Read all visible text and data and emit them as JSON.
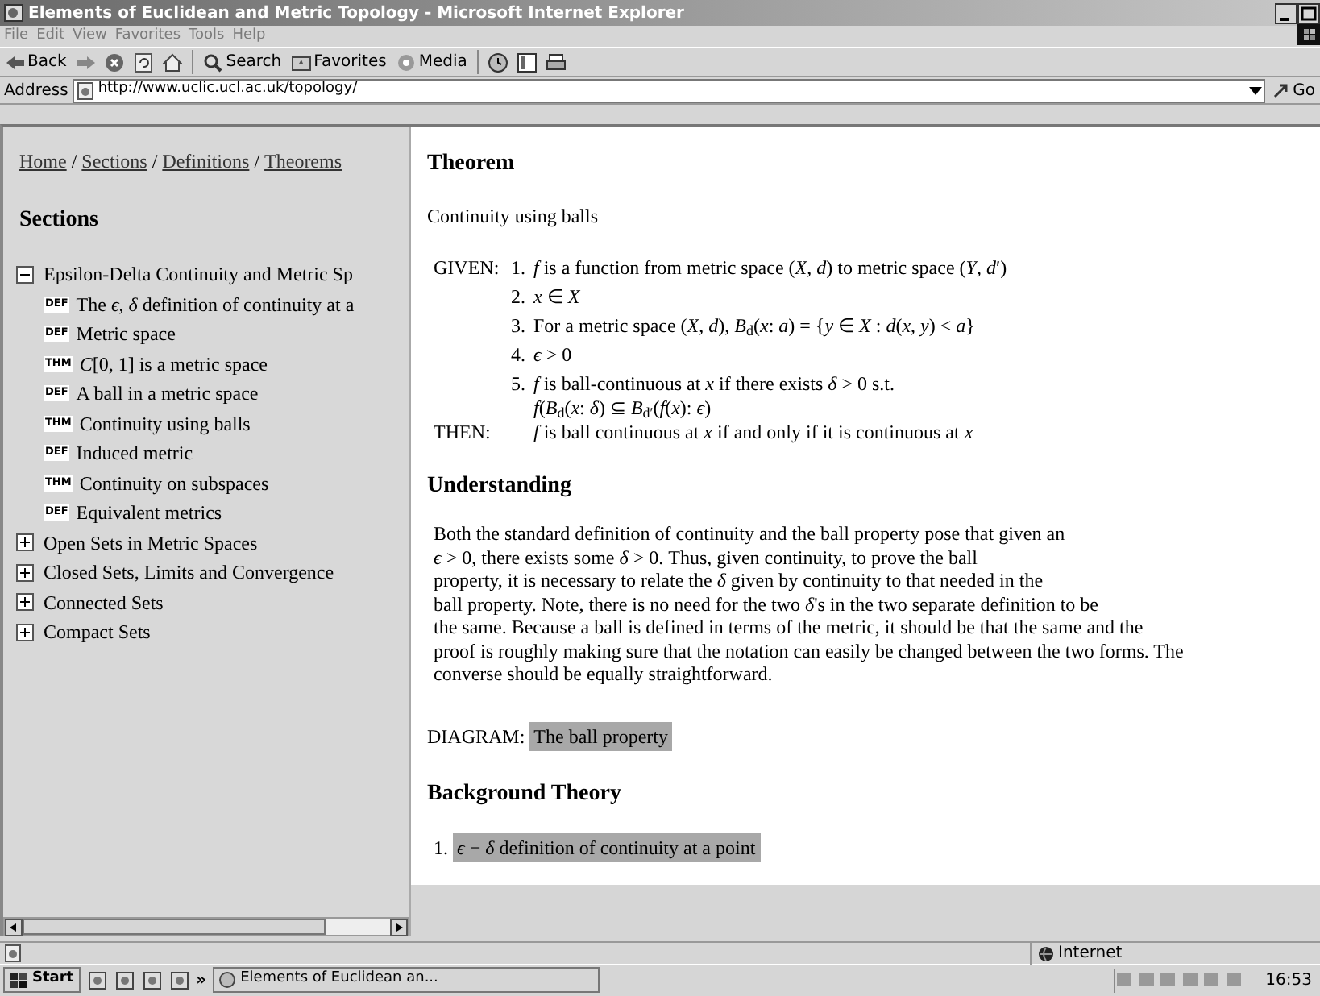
{
  "window": {
    "title": "Elements of Euclidean and Metric Topology - Microsoft Internet Explorer"
  },
  "menu": [
    "File",
    "Edit",
    "View",
    "Favorites",
    "Tools",
    "Help"
  ],
  "toolbar": [
    {
      "kind": "back",
      "label": "Back"
    },
    {
      "kind": "forward"
    },
    {
      "kind": "stop"
    },
    {
      "kind": "refresh"
    },
    {
      "kind": "home"
    },
    {
      "kind": "search",
      "label": "Search"
    },
    {
      "kind": "favorites",
      "label": "Favorites"
    },
    {
      "kind": "media",
      "label": "Media"
    },
    {
      "kind": "history"
    },
    {
      "kind": "fullscreen"
    },
    {
      "kind": "print"
    }
  ],
  "address": {
    "label": "Address",
    "value": "http://www.uclic.ucl.ac.uk/topology/",
    "go": "Go"
  },
  "sidebar": {
    "breadcrumb": [
      "Home",
      "Sections",
      "Definitions",
      "Theorems"
    ],
    "separator": "/",
    "heading": "Sections",
    "sections": [
      {
        "label": "Epsilon-Delta Continuity and Metric Sp",
        "expanded": true,
        "children": [
          {
            "tag": "DEF",
            "label": "The *ϵ*, *δ* definition of continuity at a"
          },
          {
            "tag": "DEF",
            "label": "Metric space"
          },
          {
            "tag": "THM",
            "label": "*C*[0, 1] is a metric space"
          },
          {
            "tag": "DEF",
            "label": "A ball in a metric space"
          },
          {
            "tag": "THM",
            "label": "Continuity using balls"
          },
          {
            "tag": "DEF",
            "label": "Induced metric"
          },
          {
            "tag": "THM",
            "label": "Continuity on subspaces"
          },
          {
            "tag": "DEF",
            "label": "Equivalent metrics"
          }
        ]
      },
      {
        "label": "Open Sets in Metric Spaces",
        "expanded": false
      },
      {
        "label": "Closed Sets, Limits and Convergence",
        "expanded": false
      },
      {
        "label": "Connected Sets",
        "expanded": false
      },
      {
        "label": "Compact Sets",
        "expanded": false
      }
    ]
  },
  "main": {
    "heading": "Theorem",
    "name": "Continuity using balls",
    "given_label": "GIVEN:",
    "given": [
      {
        "number": "1.",
        "lines": [
          "*f* is a function from metric space (*X*, *d*) to metric space (*Y*, *d*′)"
        ]
      },
      {
        "number": "2.",
        "lines": [
          "*x* ∈ *X*"
        ]
      },
      {
        "number": "3.",
        "lines": [
          "For a metric space (*X*, *d*), *B*$_{d}$(*x*: *a*) = {*y* ∈ *X* : *d*(*x*, *y*) < *a*}"
        ]
      },
      {
        "number": "4.",
        "lines": [
          "*ϵ* > 0"
        ]
      },
      {
        "number": "5.",
        "lines": [
          "*f* is ball-continuous at *x* if there exists *δ* > 0 s.t.",
          "*f*(*B*$_{d}$(*x*: *δ*) ⊆ *B*$_{d′}$(*f*(*x*): *ϵ*)"
        ]
      }
    ],
    "then_label": "THEN:",
    "then": "*f* is ball continuous at *x* if and only if it is continuous at *x*",
    "understanding_heading": "Understanding",
    "understanding": [
      "Both the standard definition of continuity and the ball property pose that given an",
      "*ϵ* > 0, there exists some *δ* > 0. Thus, given continuity, to prove the ball",
      "property, it is necessary to relate the *δ* given by continuity to that needed in the",
      "ball property. Note, there is no need for the two *δ*'s in the two separate definition to be",
      "the same. Because a ball is defined in terms of the metric, it should be that the same and the",
      "proof is roughly making sure that the notation can easily be changed between the two forms. The",
      "converse should be equally straightforward."
    ],
    "diagram_label": "DIAGRAM:",
    "diagram_link": "The ball property",
    "background_heading": "Background Theory",
    "background": [
      {
        "number": "1.",
        "label": "*ϵ* − *δ* definition of continuity at a point"
      }
    ]
  },
  "status_bar": {
    "zone": "Internet"
  },
  "taskbar": {
    "start": "Start",
    "more": "»",
    "task": "Elements of Euclidean an...",
    "clock": "16:53"
  }
}
